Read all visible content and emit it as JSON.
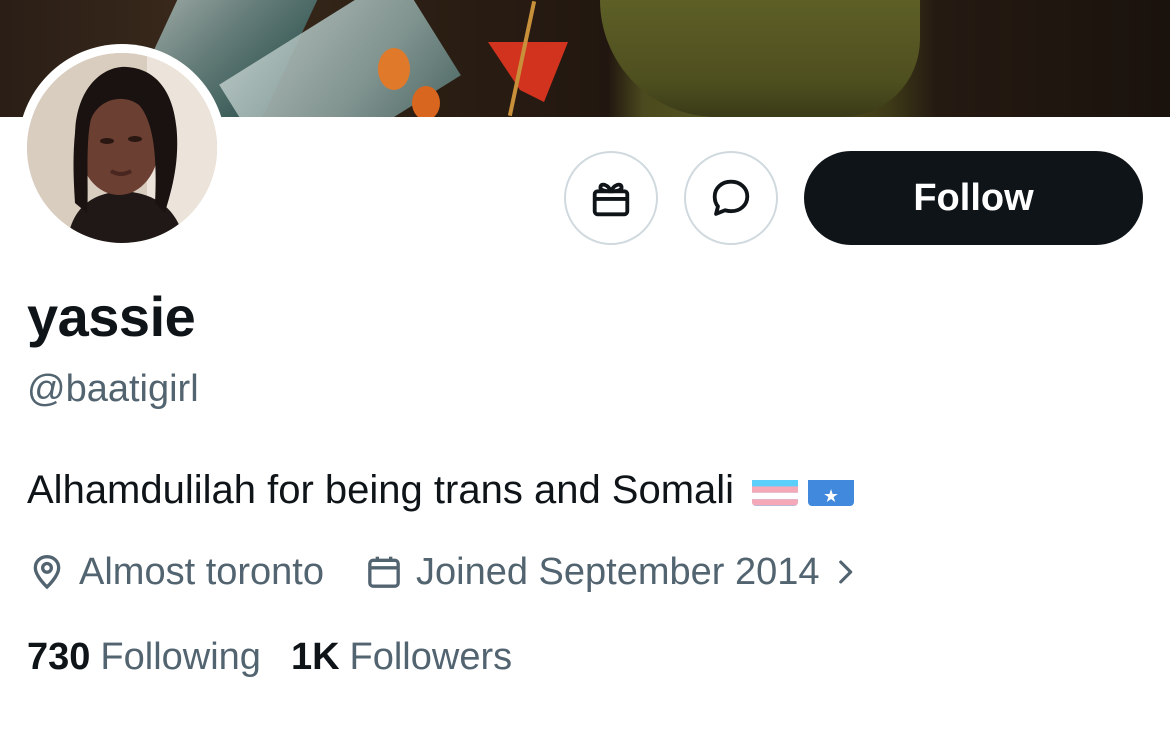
{
  "profile": {
    "display_name": "yassie",
    "handle": "@baatigirl",
    "bio": "Alhamdulilah for being trans and Somali",
    "bio_emojis": [
      "transgender-flag",
      "somalia-flag"
    ],
    "location": "Almost toronto",
    "joined": "Joined September 2014"
  },
  "actions": {
    "gift_icon": "gift-icon",
    "message_icon": "message-icon",
    "follow_label": "Follow"
  },
  "stats": {
    "following_count": "730",
    "following_label": "Following",
    "followers_count": "1K",
    "followers_label": "Followers"
  },
  "colors": {
    "text_primary": "#0f1419",
    "text_secondary": "#536471",
    "button_border": "#cfd9de",
    "follow_bg": "#0f1419"
  }
}
